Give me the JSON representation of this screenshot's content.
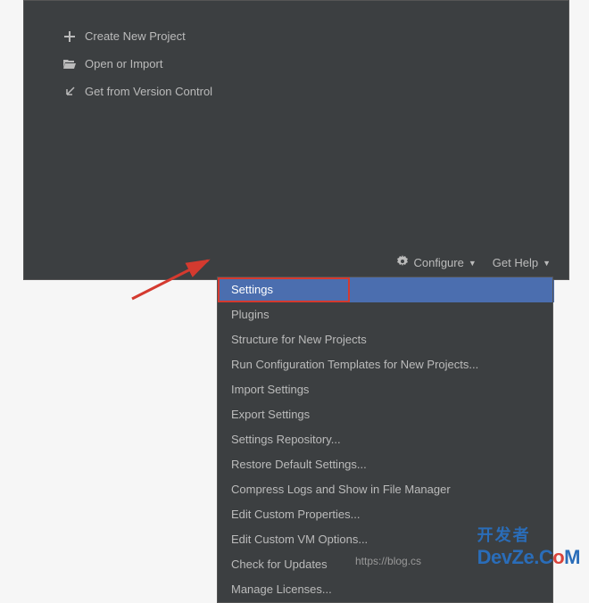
{
  "welcome": {
    "actions": {
      "create": "Create New Project",
      "open": "Open or Import",
      "vcs": "Get from Version Control"
    },
    "footer": {
      "configure": "Configure",
      "help": "Get Help"
    }
  },
  "menu": {
    "items": [
      "Settings",
      "Plugins",
      "Structure for New Projects",
      "Run Configuration Templates for New Projects...",
      "Import Settings",
      "Export Settings",
      "Settings Repository...",
      "Restore Default Settings...",
      "Compress Logs and Show in File Manager",
      "Edit Custom Properties...",
      "Edit Custom VM Options...",
      "Check for Updates",
      "Manage Licenses..."
    ]
  },
  "status_url": "https://blog.cs",
  "watermark": {
    "cn": "开发者",
    "en_pre": "DevZe.C",
    "en_o": "o",
    "en_m": "M"
  }
}
